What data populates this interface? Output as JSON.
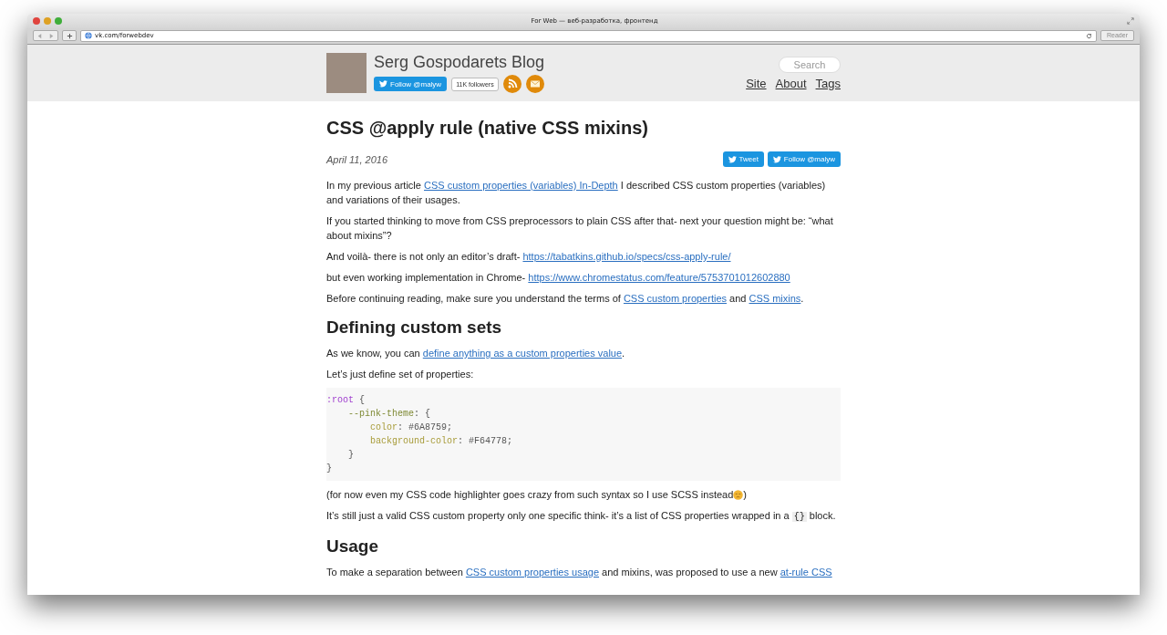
{
  "window": {
    "title": "For Web — веб-разработка, фронтенд"
  },
  "toolbar": {
    "address": "vk.com/forwebdev",
    "reader_button": {
      "label": "Reader",
      "disabled": true
    }
  },
  "site_header": {
    "blog_title": "Serg Gospodarets Blog",
    "follow_button": "Follow @malyw",
    "followers": "11K followers",
    "search": {
      "placeholder": "Search"
    },
    "nav": [
      "Site",
      "About",
      "Tags"
    ]
  },
  "article": {
    "title": "CSS @apply rule (native CSS mixins)",
    "date": "April 11, 2016",
    "share_buttons": [
      "Tweet",
      "Follow @malyw"
    ],
    "blocks": [
      {
        "kind": "paragraph",
        "segments": [
          {
            "kind": "text",
            "text": "In my previous article "
          },
          {
            "kind": "link",
            "text": "CSS custom properties (variables) In-Depth"
          },
          {
            "kind": "text",
            "text": " I described CSS custom properties (variables) and variations of their usages."
          }
        ]
      },
      {
        "kind": "paragraph",
        "segments": [
          {
            "kind": "text",
            "text": "If you started thinking to move from CSS preprocessors to plain CSS after that- next your question might be: “what about mixins”?"
          }
        ]
      },
      {
        "kind": "paragraph",
        "segments": [
          {
            "kind": "text",
            "text": "And voilà- there is not only an editor’s draft- "
          },
          {
            "kind": "link",
            "text": "https://tabatkins.github.io/specs/css-apply-rule/"
          }
        ]
      },
      {
        "kind": "paragraph",
        "segments": [
          {
            "kind": "text",
            "text": "but even working implementation in Chrome- "
          },
          {
            "kind": "link",
            "text": "https://www.chromestatus.com/feature/5753701012602880"
          }
        ]
      },
      {
        "kind": "paragraph",
        "segments": [
          {
            "kind": "text",
            "text": "Before continuing reading, make sure you understand the terms of "
          },
          {
            "kind": "link",
            "text": "CSS custom properties"
          },
          {
            "kind": "text",
            "text": " and "
          },
          {
            "kind": "link",
            "text": "CSS mixins"
          },
          {
            "kind": "text",
            "text": "."
          }
        ]
      },
      {
        "kind": "heading",
        "text": "Defining custom sets"
      },
      {
        "kind": "paragraph",
        "segments": [
          {
            "kind": "text",
            "text": "As we know, you can "
          },
          {
            "kind": "link",
            "text": "define anything as a custom properties value"
          },
          {
            "kind": "text",
            "text": "."
          }
        ]
      },
      {
        "kind": "paragraph",
        "segments": [
          {
            "kind": "text",
            "text": "Let’s just define set of properties:"
          }
        ]
      },
      {
        "kind": "code",
        "lines": [
          [
            {
              "kind": "selector",
              "text": ":root"
            },
            {
              "kind": "plain",
              "text": " {"
            }
          ],
          [
            {
              "kind": "property",
              "text": "    --pink-theme"
            },
            {
              "kind": "plain",
              "text": ": {"
            }
          ],
          [
            {
              "kind": "attribute",
              "text": "        color"
            },
            {
              "kind": "plain",
              "text": ": #6A8759;"
            }
          ],
          [
            {
              "kind": "attribute",
              "text": "        background-color"
            },
            {
              "kind": "plain",
              "text": ": #F64778;"
            }
          ],
          [
            {
              "kind": "plain",
              "text": "    }"
            }
          ],
          [
            {
              "kind": "plain",
              "text": "}"
            }
          ]
        ]
      },
      {
        "kind": "paragraph",
        "emoji": true,
        "segments": [
          {
            "kind": "text",
            "text": "(for now even my CSS code highlighter goes crazy from such syntax so I use SCSS instead"
          }
        ],
        "after": ")"
      },
      {
        "kind": "paragraph",
        "segments": [
          {
            "kind": "text",
            "text": "It’s still just a valid CSS custom property only one specific think- it’s a list of CSS properties wrapped in a "
          },
          {
            "kind": "code",
            "text": "{}"
          },
          {
            "kind": "text",
            "text": " block."
          }
        ]
      },
      {
        "kind": "heading",
        "text": "Usage"
      },
      {
        "kind": "paragraph",
        "segments": [
          {
            "kind": "text",
            "text": "To make a separation between "
          },
          {
            "kind": "link",
            "text": "CSS custom properties usage"
          },
          {
            "kind": "text",
            "text": " and mixins, was proposed to use a new "
          },
          {
            "kind": "link",
            "text": "at-rule CSS"
          }
        ]
      }
    ]
  }
}
